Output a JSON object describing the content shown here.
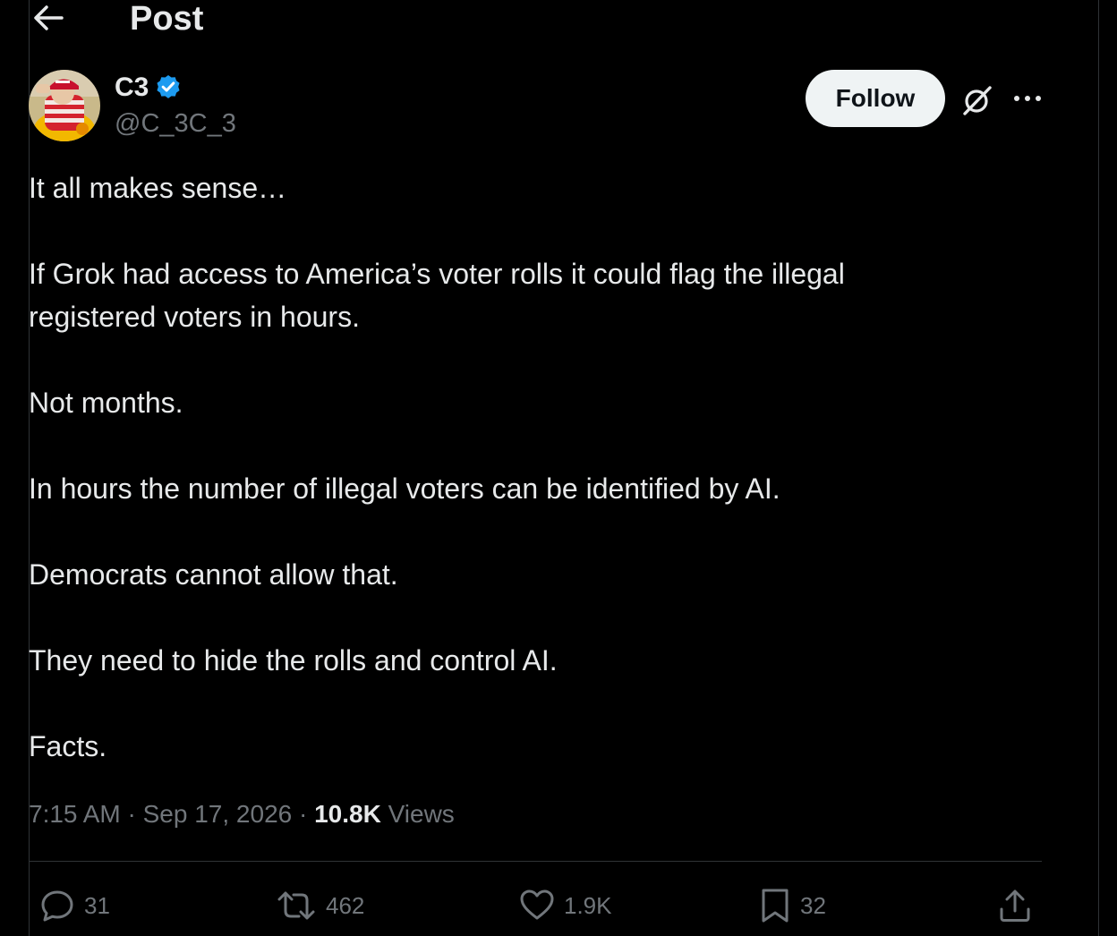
{
  "header": {
    "title": "Post",
    "back_icon": "arrow-left-icon"
  },
  "author": {
    "display_name": "C3",
    "handle": "@C_3C_3",
    "verified": true,
    "verified_color": "#1d9bf0"
  },
  "actions_top": {
    "follow_label": "Follow",
    "grok_icon": "grok-icon",
    "more_icon": "more-dots-icon"
  },
  "post": {
    "paragraphs": [
      "It all makes sense…",
      "If Grok had access to America’s voter rolls it could flag the illegal\nregistered voters in hours.",
      "Not months.",
      "In hours the number of illegal voters can be identified by AI.",
      "Democrats cannot allow that.",
      "They need to hide the rolls and control AI.",
      "Facts."
    ],
    "time": "7:15 AM",
    "date": "Sep 17, 2026",
    "views_count": "10.8K",
    "views_label": "Views"
  },
  "engagement": {
    "replies": "31",
    "reposts": "462",
    "likes": "1.9K",
    "bookmarks": "32"
  },
  "colors": {
    "background": "#000000",
    "text": "#e7e9ea",
    "muted": "#71767b",
    "border": "#2f3336",
    "accent": "#1d9bf0"
  }
}
